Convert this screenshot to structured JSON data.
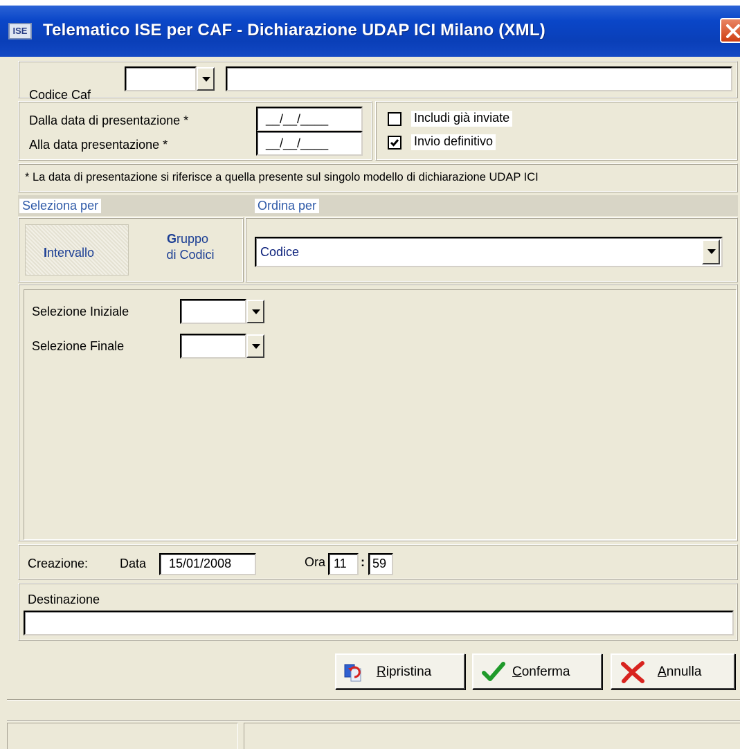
{
  "window": {
    "icon_text": "ISE",
    "title": "Telematico ISE per CAF - Dichiarazione UDAP ICI Milano (XML)"
  },
  "caf": {
    "label": "Codice Caf",
    "code_value": "",
    "description_value": ""
  },
  "dates": {
    "from_label": "Dalla data di presentazione *",
    "to_label": "Alla data presentazione *",
    "from_value": "__/__/____",
    "to_value": "__/__/____"
  },
  "options": {
    "include_sent_label": "Includi già inviate",
    "include_sent_checked": false,
    "definitive_label": "Invio definitivo",
    "definitive_checked": true
  },
  "note": "* La data di presentazione si riferisce a quella presente sul singolo modello di dichiarazione UDAP ICI",
  "select_by": {
    "header": "Seleziona per",
    "tab_interval_first": "I",
    "tab_interval_rest": "ntervallo",
    "tab_group_first": "G",
    "tab_group_line1_rest": "ruppo",
    "tab_group_line2": "di Codici"
  },
  "order_by": {
    "header": "Ordina per",
    "selected": "Codice"
  },
  "selection": {
    "initial_label": "Selezione Iniziale",
    "final_label": "Selezione Finale",
    "initial_value": "",
    "final_value": ""
  },
  "creation": {
    "label": "Creazione:",
    "date_label": "Data",
    "date_value": "15/01/2008",
    "time_label": "Ora",
    "hour": "11",
    "separator": ":",
    "minute": "59"
  },
  "destination": {
    "label": "Destinazione",
    "value": ""
  },
  "buttons": {
    "reset_hotkey": "R",
    "reset_rest": "ipristina",
    "confirm_hotkey": "C",
    "confirm_rest": "onferma",
    "cancel_hotkey": "A",
    "cancel_rest": "nnulla"
  },
  "colors": {
    "title_bar": "#0a46c8",
    "face": "#ece9d8",
    "header_blue": "#2f5aa8",
    "confirm_green": "#1f9a2a",
    "cancel_red": "#d8231f"
  }
}
